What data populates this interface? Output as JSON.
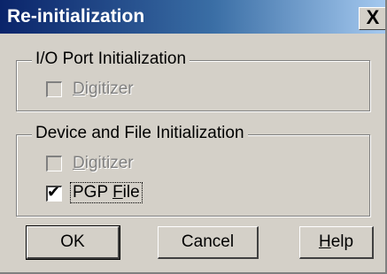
{
  "window": {
    "title": "Re-initialization",
    "close_label": "X"
  },
  "io_group": {
    "label": "I/O Port Initialization",
    "digitizer": {
      "label_first": "D",
      "label_rest": "igitizer",
      "checked": false,
      "enabled": false
    }
  },
  "device_group": {
    "label": "Device and File Initialization",
    "digitizer": {
      "label_first": "D",
      "label_rest": "igitizer",
      "checked": false,
      "enabled": false
    },
    "pgp_file": {
      "label_pre": "PGP ",
      "label_underlined": "F",
      "label_rest": "ile",
      "checked": true,
      "enabled": true,
      "check_glyph": "✔"
    }
  },
  "buttons": {
    "ok": "OK",
    "cancel": "Cancel",
    "help_first": "H",
    "help_rest": "elp"
  }
}
